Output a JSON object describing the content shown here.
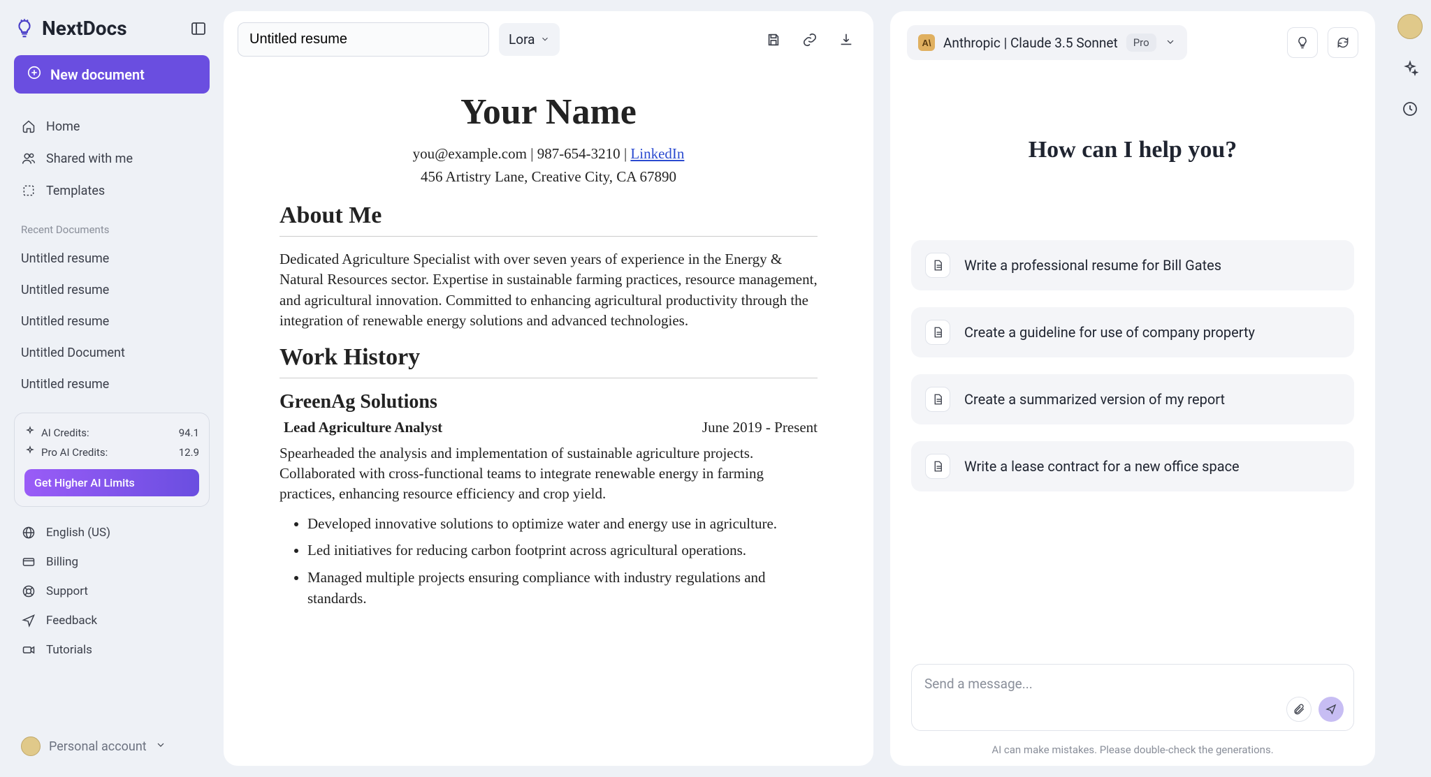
{
  "brand": {
    "name": "NextDocs"
  },
  "sidebar": {
    "new_doc_label": "New document",
    "nav": [
      {
        "label": "Home"
      },
      {
        "label": "Shared with me"
      },
      {
        "label": "Templates"
      }
    ],
    "recent_header": "Recent Documents",
    "recent": [
      "Untitled resume",
      "Untitled resume",
      "Untitled resume",
      "Untitled Document",
      "Untitled resume"
    ],
    "credits": {
      "ai_label": "AI Credits:",
      "ai_value": "94.1",
      "pro_label": "Pro AI Credits:",
      "pro_value": "12.9",
      "cta": "Get Higher AI Limits"
    },
    "footer": [
      {
        "label": "English (US)"
      },
      {
        "label": "Billing"
      },
      {
        "label": "Support"
      },
      {
        "label": "Feedback"
      },
      {
        "label": "Tutorials"
      }
    ],
    "account_label": "Personal account"
  },
  "doc": {
    "title_input": "Untitled resume",
    "font": "Lora",
    "content": {
      "name": "Your Name",
      "email": "you@example.com",
      "phone": "987-654-3210",
      "linkedin": "LinkedIn",
      "address": "456 Artistry Lane, Creative City, CA 67890",
      "about_heading": "About Me",
      "about_text": "Dedicated Agriculture Specialist with over seven years of experience in the Energy & Natural Resources sector. Expertise in sustainable farming practices, resource management, and agricultural innovation. Committed to enhancing agricultural productivity through the integration of renewable energy solutions and advanced technologies.",
      "work_heading": "Work History",
      "job_company": "GreenAg Solutions",
      "job_title": "Lead Agriculture Analyst",
      "job_dates": "June 2019 - Present",
      "job_summary": "Spearheaded the analysis and implementation of sustainable agriculture projects. Collaborated with cross-functional teams to integrate renewable energy in farming practices, enhancing resource efficiency and crop yield.",
      "bullets": [
        "Developed innovative solutions to optimize water and energy use in agriculture.",
        "Led initiatives for reducing carbon footprint across agricultural operations.",
        "Managed multiple projects ensuring compliance with industry regulations and standards."
      ]
    }
  },
  "ai": {
    "model_name": "Anthropic | Claude 3.5 Sonnet",
    "pro_badge": "Pro",
    "greeting": "How can I help you?",
    "suggestions": [
      "Write a professional resume for Bill Gates",
      "Create a guideline for use of company property",
      "Create a summarized version of my report",
      "Write a lease contract for a new office space"
    ],
    "input_placeholder": "Send a message...",
    "disclaimer": "AI can make mistakes. Please double-check the generations."
  }
}
